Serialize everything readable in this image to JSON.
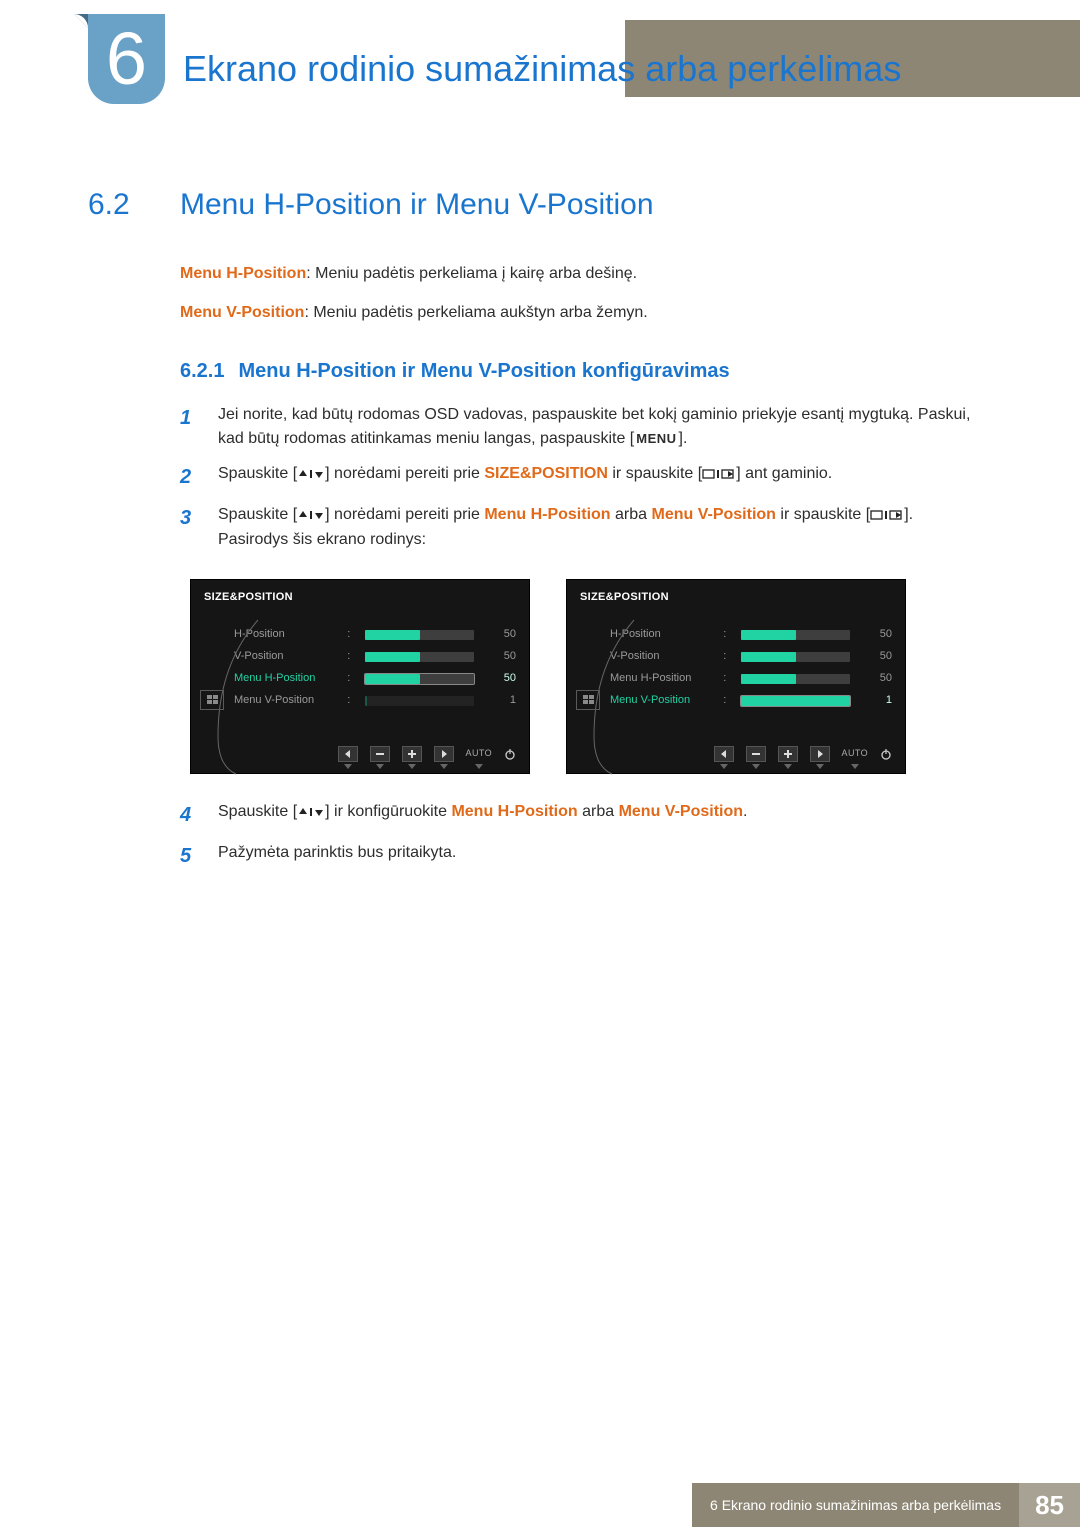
{
  "chapter": {
    "number": "6",
    "title": "Ekrano rodinio sumažinimas arba perkėlimas"
  },
  "section": {
    "number": "6.2",
    "title": "Menu H-Position ir Menu V-Position"
  },
  "intro": {
    "h_label": "Menu H-Position",
    "h_text": ": Meniu padėtis perkeliama į kairę arba dešinę.",
    "v_label": "Menu V-Position",
    "v_text": ": Meniu padėtis perkeliama aukštyn arba žemyn."
  },
  "subsection": {
    "number": "6.2.1",
    "title": "Menu H-Position ir Menu V-Position konfigūravimas"
  },
  "steps": {
    "s1a": "Jei norite, kad būtų rodomas OSD vadovas, paspauskite bet kokį gaminio priekyje esantį mygtuką. Paskui, kad būtų rodomas atitinkamas meniu langas, paspauskite [",
    "s1_menu": "MENU",
    "s1b": "].",
    "s2a": "Spauskite [",
    "s2b": "] norėdami pereiti prie ",
    "s2_target": "SIZE&POSITION",
    "s2c": " ir spauskite [",
    "s2d": "] ant gaminio.",
    "s3a": "Spauskite [",
    "s3b": "] norėdami pereiti prie ",
    "s3_h": "Menu H-Position",
    "s3_or": " arba ",
    "s3_v": "Menu V-Position",
    "s3c": " ir spauskite [",
    "s3d": "]. Pasirodys šis ekrano rodinys:",
    "s4a": "Spauskite [",
    "s4b": "] ir konfigūruokite ",
    "s4_h": "Menu H-Position",
    "s4_or": " arba ",
    "s4_v": "Menu V-Position",
    "s4c": ".",
    "s5": "Pažymėta parinktis bus pritaikyta."
  },
  "nums": {
    "n1": "1",
    "n2": "2",
    "n3": "3",
    "n4": "4",
    "n5": "5"
  },
  "osd": {
    "title": "SIZE&POSITION",
    "labels": {
      "hpos": "H-Position",
      "vpos": "V-Position",
      "menuh": "Menu H-Position",
      "menuv": "Menu V-Position"
    },
    "left": {
      "hpos": "50",
      "vpos": "50",
      "menuh": "50",
      "menuv": "1"
    },
    "right": {
      "hpos": "50",
      "vpos": "50",
      "menuh": "50",
      "menuv": "1"
    },
    "auto": "AUTO"
  },
  "footer": {
    "text": "6 Ekrano rodinio sumažinimas arba perkėlimas",
    "page": "85"
  }
}
